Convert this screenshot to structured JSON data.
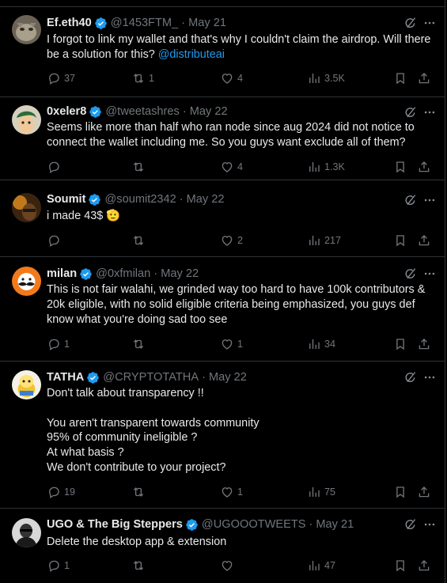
{
  "tweets": [
    {
      "name": "Ef.eth40",
      "handle": "@1453FTM_",
      "date": "· May 21",
      "text_before": "I forgot to link my wallet and that's why I couldn't claim the airdrop. Will there be a solution for this? ",
      "mention": "@distributeai",
      "replies": "37",
      "reposts": "1",
      "likes": "4",
      "views": "3.5K",
      "avatar": "grey-cat-avatar"
    },
    {
      "name": "0xeler8",
      "handle": "@tweetashres",
      "date": "· May 22",
      "text": "Seems like more than half who ran node since aug 2024 did not notice to connect the wallet including me. So you guys want exclude all of them?",
      "replies": "",
      "reposts": "",
      "likes": "4",
      "views": "1.3K",
      "avatar": "anime-boy-avatar"
    },
    {
      "name": "Soumit",
      "handle": "@soumit2342",
      "date": "· May 22",
      "text": "i made 43$ ",
      "emoji": "🫡",
      "replies": "",
      "reposts": "",
      "likes": "2",
      "views": "217",
      "avatar": "dark-portrait-avatar"
    },
    {
      "name": "milan",
      "handle": "@0xfmilan",
      "date": "· May 22",
      "text": "This is not fair walahi, we grinded way too hard to have 100k contributors & 20k eligible, with no solid eligible criteria being emphasized, you guys def know what you're doing sad too see",
      "replies": "1",
      "reposts": "",
      "likes": "1",
      "views": "34",
      "avatar": "orange-mustache-avatar"
    },
    {
      "name": "TATHA",
      "handle": "@CRYPTOTATHA",
      "date": "· May 22",
      "text": "Don't talk about transparency !!\n\nYou aren't transparent towards community\n95% of community ineligible ?\nAt what basis ?\nWe don't contribute to your project?",
      "replies": "19",
      "reposts": "",
      "likes": "1",
      "views": "75",
      "avatar": "cartoon-character-avatar"
    },
    {
      "name": "UGO & The Big Steppers",
      "handle": "@UGOOOTWEETS",
      "date": "· May 21",
      "text": "Delete the desktop app & extension",
      "replies": "1",
      "reposts": "",
      "likes": "",
      "views": "47",
      "avatar": "bw-portrait-avatar"
    }
  ],
  "colors": {
    "background": "#000000",
    "text": "#e7e9ea",
    "muted": "#71767b",
    "link": "#1d9bf0",
    "verified": "#1d9bf0",
    "border": "#2f3336"
  },
  "icons": [
    "reply-icon",
    "repost-icon",
    "like-icon",
    "views-icon",
    "bookmark-icon",
    "share-icon",
    "grok-icon",
    "more-icon",
    "verified-badge-icon"
  ]
}
